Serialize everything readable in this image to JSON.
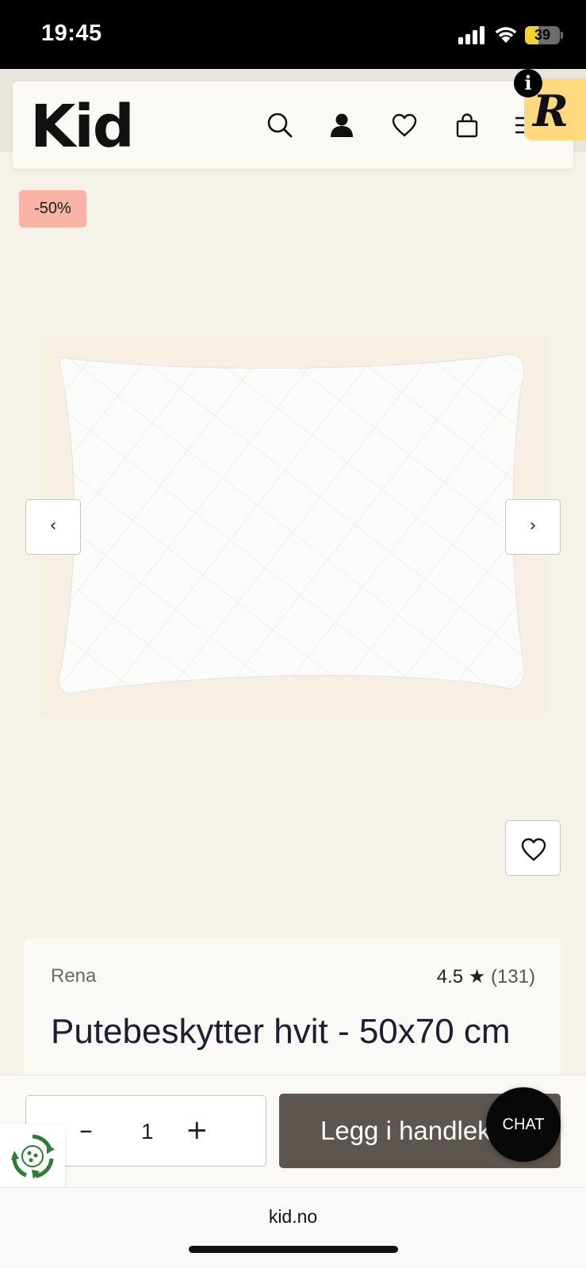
{
  "status_bar": {
    "time": "19:45",
    "battery": "39",
    "battery_level": 0.39
  },
  "header": {
    "logo": "Kid",
    "icons": [
      "search-icon",
      "user-icon",
      "heart-icon",
      "bag-icon",
      "menu-icon"
    ],
    "badge_letter": "R",
    "info_letter": "i"
  },
  "product": {
    "discount": "-50%",
    "prev_label": "‹",
    "next_label": "›",
    "brand": "Rena",
    "rating": "4.5",
    "rating_star": "★",
    "review_count": "(131)",
    "title": "Putebeskytter hvit - 50x70 cm"
  },
  "cart_bar": {
    "qty_minus": "–",
    "quantity": "1",
    "qty_plus": "+",
    "add_to_cart": "Legg i handlekurv",
    "chat": "CHAT"
  },
  "browser": {
    "url": "kid.no"
  },
  "colors": {
    "accent_button": "#5d554f",
    "discount_bg": "#f7b3a4",
    "page_bg": "#f5f2ea",
    "badge_bg": "#ffd97e"
  }
}
